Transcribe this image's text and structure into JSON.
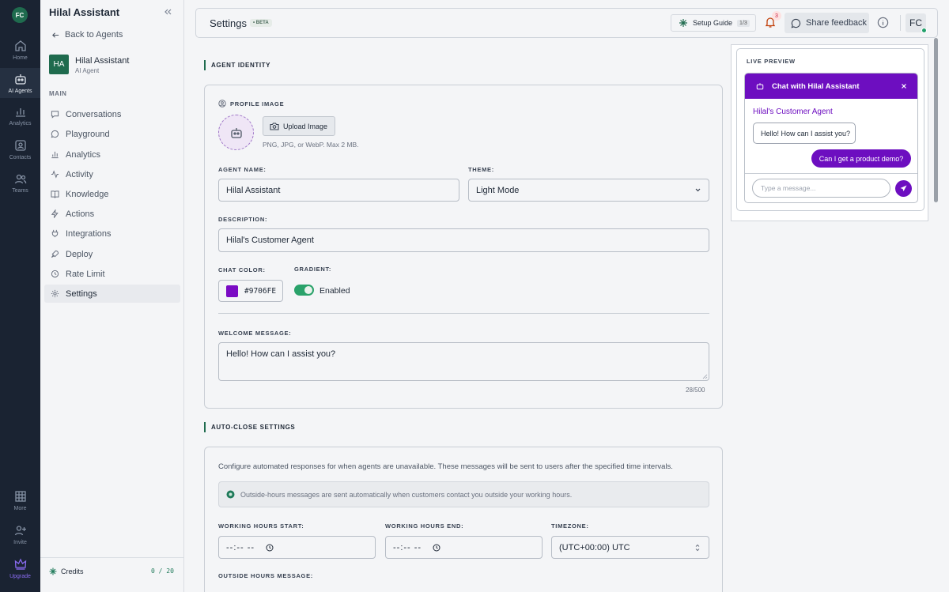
{
  "rail": {
    "logo": "FC",
    "items": [
      {
        "label": "Home",
        "icon": "home-icon"
      },
      {
        "label": "AI Agents",
        "icon": "bot-icon"
      },
      {
        "label": "Analytics",
        "icon": "chart-icon"
      },
      {
        "label": "Contacts",
        "icon": "contacts-icon"
      },
      {
        "label": "Teams",
        "icon": "teams-icon"
      }
    ],
    "bottom": [
      {
        "label": "More",
        "icon": "grid-icon"
      },
      {
        "label": "Invite",
        "icon": "invite-icon"
      },
      {
        "label": "Upgrade",
        "icon": "crown-icon"
      }
    ]
  },
  "sidebar": {
    "title": "Hilal Assistant",
    "back": "Back to Agents",
    "agent": {
      "initials": "HA",
      "name": "Hilal Assistant",
      "type": "AI Agent"
    },
    "section": "MAIN",
    "items": [
      {
        "label": "Conversations"
      },
      {
        "label": "Playground"
      },
      {
        "label": "Analytics"
      },
      {
        "label": "Activity"
      },
      {
        "label": "Knowledge"
      },
      {
        "label": "Actions"
      },
      {
        "label": "Integrations"
      },
      {
        "label": "Deploy"
      },
      {
        "label": "Rate Limit"
      },
      {
        "label": "Settings"
      }
    ],
    "credits_label": "Credits",
    "credits_value": "0 / 20"
  },
  "header": {
    "title": "Settings",
    "beta": "• BETA",
    "setup_label": "Setup Guide",
    "setup_count": "1/3",
    "notifications": "3",
    "share": "Share feedback",
    "avatar": "FC"
  },
  "identity": {
    "section": "AGENT IDENTITY",
    "profile_label": "PROFILE IMAGE",
    "upload": "Upload Image",
    "upload_hint": "PNG, JPG, or WebP. Max 2 MB.",
    "name_label": "AGENT NAME:",
    "name_value": "Hilal Assistant",
    "theme_label": "THEME:",
    "theme_value": "Light Mode",
    "desc_label": "DESCRIPTION:",
    "desc_value": "Hilal's Customer Agent",
    "color_label": "CHAT COLOR:",
    "color_value": "#9706FE",
    "color_swatch": "#7b0bc4",
    "gradient_label": "GRADIENT:",
    "gradient_value": "Enabled",
    "welcome_label": "WELCOME MESSAGE:",
    "welcome_value": "Hello! How can I assist you?",
    "welcome_count": "28/500"
  },
  "autoclose": {
    "section": "AUTO-CLOSE SETTINGS",
    "description": "Configure automated responses for when agents are unavailable. These messages will be sent to users after the specified time intervals.",
    "notice": "Outside-hours messages are sent automatically when customers contact you outside your working hours.",
    "start_label": "WORKING HOURS START:",
    "start_value": "--:-- --",
    "end_label": "WORKING HOURS END:",
    "end_value": "--:-- --",
    "tz_label": "TIMEZONE:",
    "tz_value": "(UTC+00:00) UTC",
    "outside_label": "OUTSIDE HOURS MESSAGE:"
  },
  "preview": {
    "label": "LIVE PREVIEW",
    "chat_title": "Chat with Hilal Assistant",
    "agent_label": "Hilal's Customer Agent",
    "bot_message": "Hello! How can I assist you?",
    "user_message": "Can I get a product demo?",
    "input_placeholder": "Type a message...",
    "accent": "#6d0ec0"
  }
}
